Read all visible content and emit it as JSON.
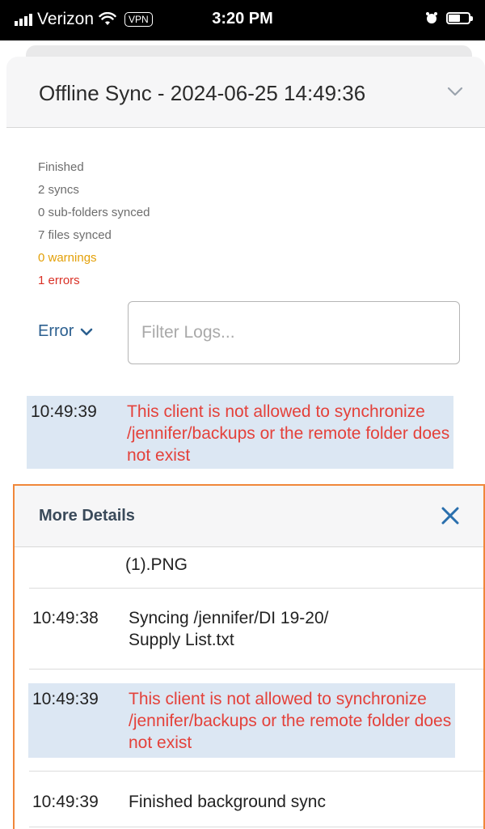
{
  "status_bar": {
    "carrier": "Verizon",
    "vpn": "VPN",
    "time": "3:20 PM"
  },
  "header": {
    "title": "Offline Sync - 2024-06-25 14:49:36",
    "expand_icon": "chevron-down-icon"
  },
  "summary": {
    "status": "Finished",
    "syncs": "2 syncs",
    "subfolders": "0 sub-folders synced",
    "files": "7 files synced",
    "warnings": "0 warnings",
    "errors": "1 errors"
  },
  "filter": {
    "level_label": "Error",
    "placeholder": "Filter Logs..."
  },
  "main_log": {
    "time": "10:49:39",
    "message": "This client is not allowed to synchronize /jennifer/backups or the remote folder does not exist"
  },
  "details": {
    "title": "More Details",
    "close_icon": "close-icon",
    "partial_row": "(1).PNG",
    "rows": [
      {
        "time": "10:49:38",
        "message": "Syncing /jennifer/DI 19-20/ Supply List.txt",
        "level": "info"
      },
      {
        "time": "10:49:39",
        "message": "This client is not allowed to synchronize /jennifer/backups or the remote folder does not exist",
        "level": "error"
      },
      {
        "time": "10:49:39",
        "message": "Finished background sync",
        "level": "info"
      }
    ]
  },
  "colors": {
    "error_text": "#e4413a",
    "warning_text": "#e3a008",
    "highlight_bg": "#dce7f3",
    "accent_blue": "#2b5f8f",
    "panel_border": "#f0873a"
  }
}
